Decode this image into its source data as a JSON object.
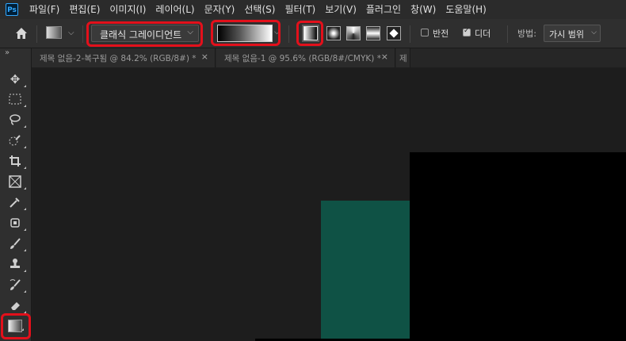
{
  "app": {
    "logo": "Ps"
  },
  "menu": [
    "파일(F)",
    "편집(E)",
    "이미지(I)",
    "레이어(L)",
    "문자(Y)",
    "선택(S)",
    "필터(T)",
    "보기(V)",
    "플러그인",
    "창(W)",
    "도움말(H)"
  ],
  "options": {
    "gradient_type": "클래식 그레이디언트",
    "reverse_label": "반전",
    "reverse_checked": false,
    "dither_label": "디더",
    "dither_checked": true,
    "mode_label": "방법:",
    "mode_value": "가시 범위"
  },
  "tabs": [
    {
      "title": "제목 없음-2-복구됨 @ 84.2% (RGB/8#) *",
      "close": "×"
    },
    {
      "title": "제목 없음-1 @ 95.6% (RGB/8#/CMYK) *",
      "close": "×"
    },
    {
      "title": "제",
      "close": ""
    }
  ],
  "toolbar": {
    "collapse": "»",
    "tools": [
      "move-tool",
      "marquee-tool",
      "lasso-tool",
      "quick-select-tool",
      "crop-tool",
      "frame-tool",
      "eyedropper-tool",
      "healing-brush-tool",
      "brush-tool",
      "clone-stamp-tool",
      "history-brush-tool",
      "eraser-tool",
      "gradient-tool"
    ]
  },
  "colors": {
    "highlight": "#e3101b",
    "canvas_teal": "#0f5245"
  }
}
